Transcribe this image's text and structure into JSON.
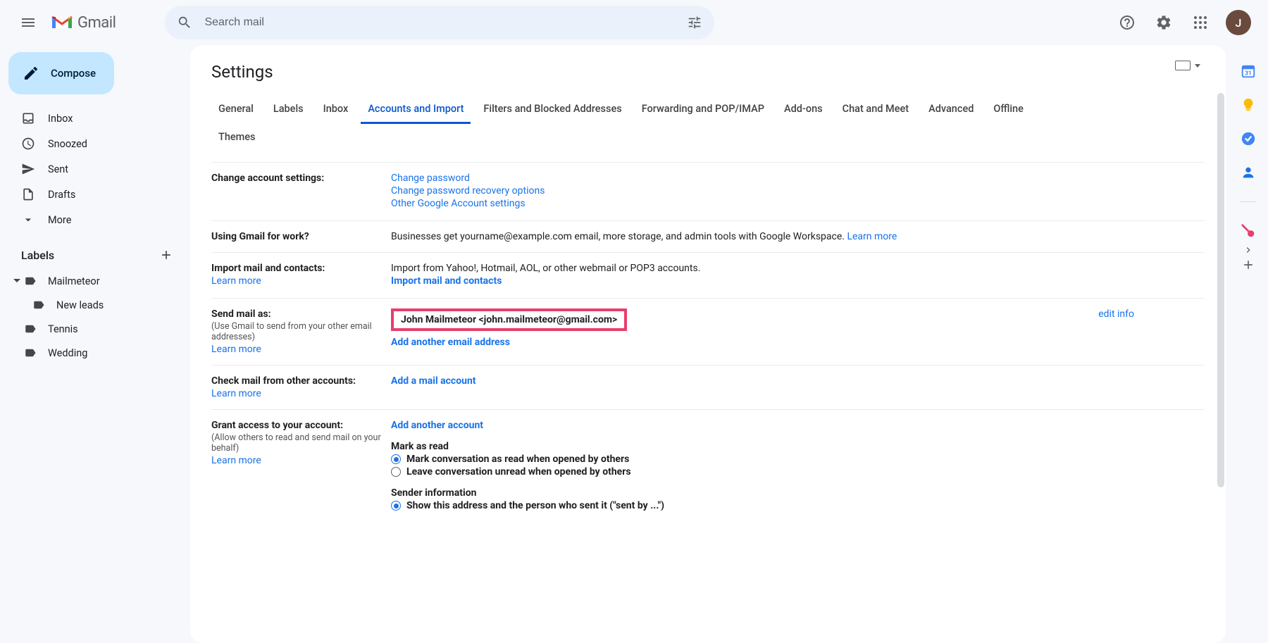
{
  "header": {
    "logoText": "Gmail",
    "searchPlaceholder": "Search mail",
    "avatarInitial": "J"
  },
  "compose": {
    "label": "Compose"
  },
  "nav": {
    "inbox": "Inbox",
    "snoozed": "Snoozed",
    "sent": "Sent",
    "drafts": "Drafts",
    "more": "More"
  },
  "labelsHeader": "Labels",
  "labels": {
    "mailmeteor": "Mailmeteor",
    "newleads": "New leads",
    "tennis": "Tennis",
    "wedding": "Wedding"
  },
  "settingsTitle": "Settings",
  "tabs": {
    "general": "General",
    "labels": "Labels",
    "inbox": "Inbox",
    "accounts": "Accounts and Import",
    "filters": "Filters and Blocked Addresses",
    "forwarding": "Forwarding and POP/IMAP",
    "addons": "Add-ons",
    "chat": "Chat and Meet",
    "advanced": "Advanced",
    "offline": "Offline",
    "themes": "Themes"
  },
  "sections": {
    "changeAccount": {
      "label": "Change account settings:",
      "changePassword": "Change password",
      "changeRecovery": "Change password recovery options",
      "otherSettings": "Other Google Account settings"
    },
    "workGmail": {
      "label": "Using Gmail for work?",
      "text": "Businesses get yourname@example.com email, more storage, and admin tools with Google Workspace. ",
      "learn": "Learn more"
    },
    "importMail": {
      "label": "Import mail and contacts:",
      "learn": "Learn more",
      "desc": "Import from Yahoo!, Hotmail, AOL, or other webmail or POP3 accounts.",
      "action": "Import mail and contacts"
    },
    "sendMailAs": {
      "label": "Send mail as:",
      "sub": "(Use Gmail to send from your other email addresses)",
      "learn": "Learn more",
      "identity": "John Mailmeteor <john.mailmeteor@gmail.com>",
      "addAnother": "Add another email address",
      "editInfo": "edit info"
    },
    "checkMail": {
      "label": "Check mail from other accounts:",
      "learn": "Learn more",
      "action": "Add a mail account"
    },
    "grantAccess": {
      "label": "Grant access to your account:",
      "sub": "(Allow others to read and send mail on your behalf)",
      "learn": "Learn more",
      "addAnother": "Add another account",
      "markAsRead": "Mark as read",
      "opt1": "Mark conversation as read when opened by others",
      "opt2": "Leave conversation unread when opened by others",
      "senderInfo": "Sender information",
      "senderOpt1": "Show this address and the person who sent it (\"sent by ...\")"
    }
  }
}
